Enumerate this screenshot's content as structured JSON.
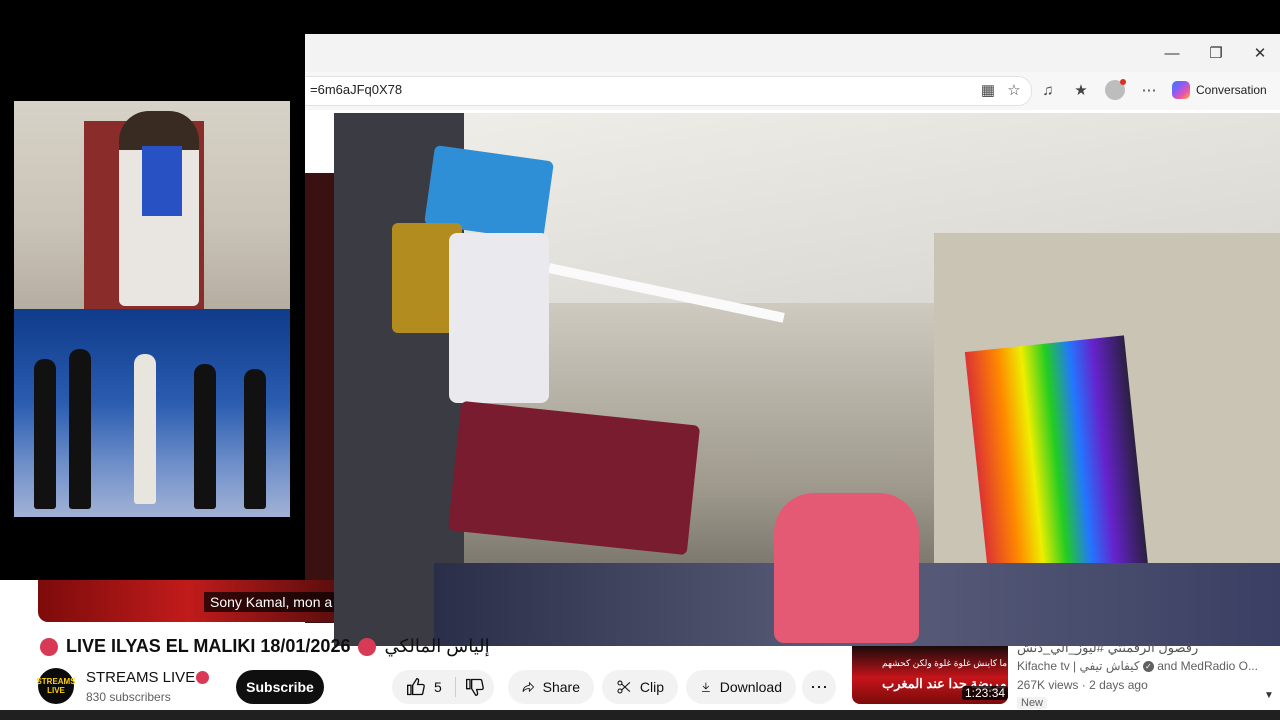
{
  "browser": {
    "url_fragment": "=6m6aJFq0X78",
    "copilot_label": "Conversation",
    "window_controls": [
      "minimize-icon",
      "restore-icon",
      "close-icon"
    ]
  },
  "player": {
    "caption": "Sony Kamal, mon a"
  },
  "video": {
    "title": "LIVE ILYAS EL MALIKI 18/01/2026",
    "title_arabic": "إلياس المالكي"
  },
  "channel": {
    "avatar_text": "STREAMS LIVE",
    "name": "STREAMS LIVE",
    "subscribers": "830 subscribers",
    "subscribe_label": "Subscribe"
  },
  "actions": {
    "like_count": "5",
    "share_label": "Share",
    "clip_label": "Clip",
    "download_label": "Download"
  },
  "recommendation": {
    "thumb_text1": "ما كاينش غلوة غلوة ولكن كحشهم",
    "thumb_text2": "الجزائر مريضة جدا عند المغرب!",
    "duration": "1:23:34",
    "title_partial": "رقصول الرقمنتي #ليوز_الي_دنش",
    "channel": "Kifache tv | كيفاش تيفي",
    "channel_extra": "and MedRadio O...",
    "views": "267K views",
    "age": "2 days ago",
    "badge": "New"
  },
  "colors": {
    "brand_red": "#d83a55",
    "subscribe_bg": "#0f0f0f",
    "pill_bg": "#f2f2f2"
  }
}
